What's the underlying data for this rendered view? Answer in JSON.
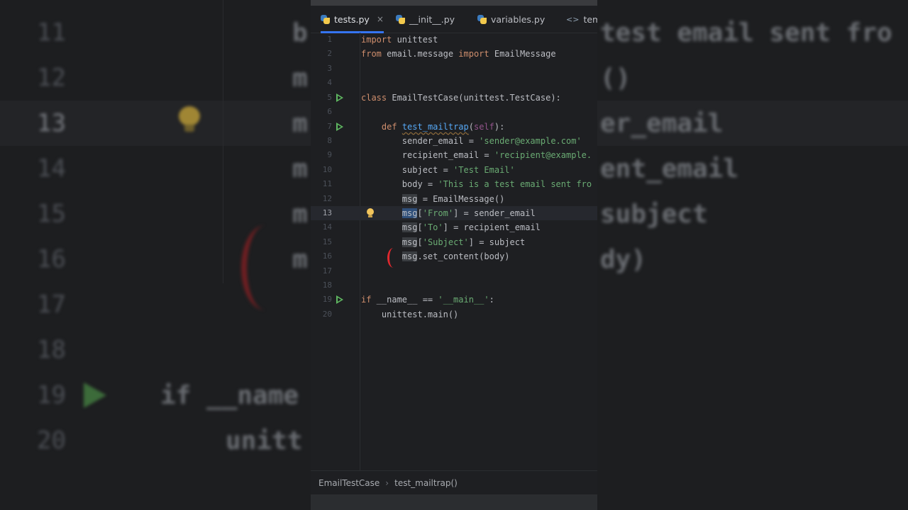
{
  "tabs": [
    {
      "label": "tests.py",
      "active": true,
      "icon": "python-file-icon",
      "closable": true
    },
    {
      "label": "__init__.py",
      "active": false,
      "icon": "python-file-icon"
    },
    {
      "label": "variables.py",
      "active": false,
      "icon": "python-file-icon"
    },
    {
      "label": "temp",
      "active": false,
      "icon": "html-file-icon"
    }
  ],
  "tab_close_glyph": "×",
  "html_glyph": "<>",
  "current_line": 13,
  "line_numbers": [
    "1",
    "2",
    "3",
    "4",
    "5",
    "6",
    "7",
    "8",
    "9",
    "10",
    "11",
    "12",
    "13",
    "14",
    "15",
    "16",
    "17",
    "18",
    "19",
    "20"
  ],
  "code": {
    "l1": {
      "kw": "import",
      "rest": " unittest"
    },
    "l2": {
      "kw1": "from",
      "mod": " email.message ",
      "kw2": "import",
      "rest": " EmailMessage"
    },
    "l5": {
      "kw": "class",
      "rest": " EmailTestCase(unittest.TestCase):"
    },
    "l7": {
      "kw": "def",
      "fn": "test_mailtrap",
      "open": "(",
      "self": "self",
      "close": "):"
    },
    "l8": {
      "lhs": "sender_email = ",
      "str": "'sender@example.com'"
    },
    "l9": {
      "lhs": "recipient_email = ",
      "str": "'recipient@example."
    },
    "l10": {
      "lhs": "subject = ",
      "str": "'Test Email'"
    },
    "l11": {
      "lhs": "body = ",
      "str": "'This is a test email sent fro"
    },
    "l12": {
      "var": "msg",
      "rest": " = EmailMessage()"
    },
    "l13": {
      "var": "msg",
      "open": "[",
      "str": "'From'",
      "rest": "] = sender_email"
    },
    "l14": {
      "var": "msg",
      "open": "[",
      "str": "'To'",
      "rest": "] = recipient_email"
    },
    "l15": {
      "var": "msg",
      "open": "[",
      "str": "'Subject'",
      "rest": "] = subject"
    },
    "l16": {
      "var": "msg",
      "rest": ".set_content(body)"
    },
    "l19": {
      "kw": "if",
      "mid": " __name__ == ",
      "str": "'__main__'",
      "rest": ":"
    },
    "l20": {
      "rest": "unittest.main()"
    }
  },
  "breadcrumb": {
    "class": "EmailTestCase",
    "sep": "›",
    "method": "test_mailtrap()"
  },
  "background": {
    "nums": [
      "11",
      "12",
      "13",
      "14",
      "15",
      "16",
      "17",
      "18",
      "19",
      "20"
    ],
    "code_fragments": [
      "b",
      "m",
      "m",
      "m",
      "m",
      "m",
      "m",
      "if __name",
      "unitt"
    ],
    "right_fragments": [
      "test email sent fro",
      "()",
      "er_email",
      "ent_email",
      "subject",
      "dy)"
    ]
  },
  "colors": {
    "accent": "#3574f0",
    "keyword": "#cf8e6d",
    "string": "#6aab73",
    "function": "#56a8f5",
    "self": "#94558d",
    "run": "#5fb761"
  }
}
